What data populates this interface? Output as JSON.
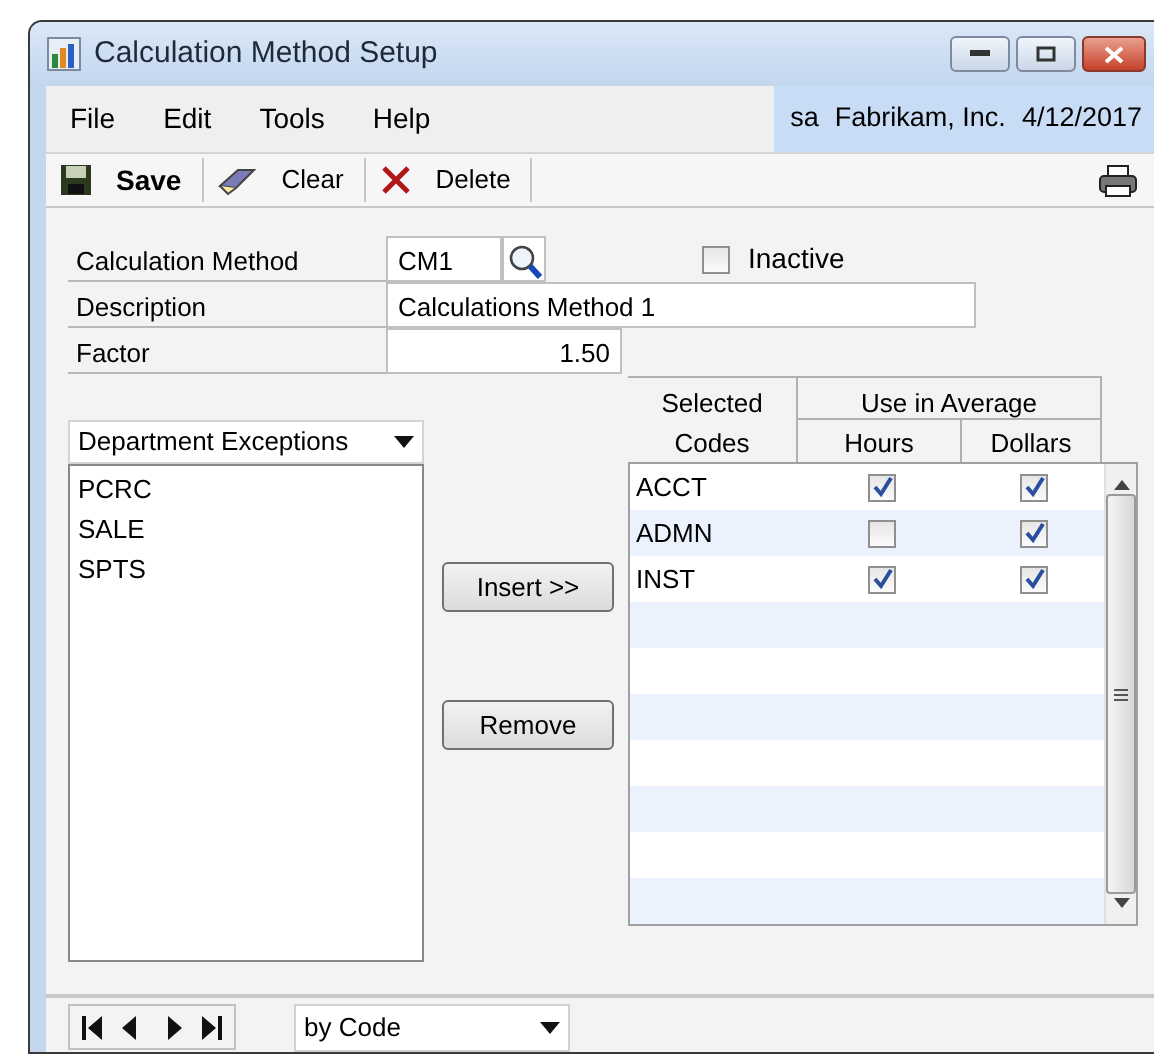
{
  "window": {
    "title": "Calculation Method Setup"
  },
  "menu": [
    "File",
    "Edit",
    "Tools",
    "Help"
  ],
  "user_info": {
    "user": "sa",
    "company": "Fabrikam, Inc.",
    "date": "4/12/2017"
  },
  "toolbar": [
    {
      "kind": "save",
      "label": "Save"
    },
    {
      "kind": "clear",
      "label": "Clear"
    },
    {
      "kind": "delete",
      "label": "Delete"
    }
  ],
  "form": {
    "calculation_method": {
      "label": "Calculation Method",
      "value": "CM1"
    },
    "inactive": {
      "label": "Inactive",
      "checked": false
    },
    "description": {
      "label": "Description",
      "value": "Calculations Method 1"
    },
    "factor": {
      "label": "Factor",
      "value": "1.50"
    }
  },
  "exceptions": {
    "dropdown": "Department Exceptions",
    "items": [
      "PCRC",
      "SALE",
      "SPTS"
    ]
  },
  "buttons": [
    "Insert >>",
    "Remove"
  ],
  "grid": {
    "headers": {
      "selected_top": "Selected",
      "selected_bottom": "Codes",
      "use_in_average": "Use in Average",
      "hours": "Hours",
      "dollars": "Dollars"
    },
    "rows": [
      {
        "code": "ACCT",
        "hours": true,
        "dollars": true
      },
      {
        "code": "ADMN",
        "hours": false,
        "dollars": true
      },
      {
        "code": "INST",
        "hours": true,
        "dollars": true
      }
    ]
  },
  "footer": {
    "sort": "by Code"
  }
}
